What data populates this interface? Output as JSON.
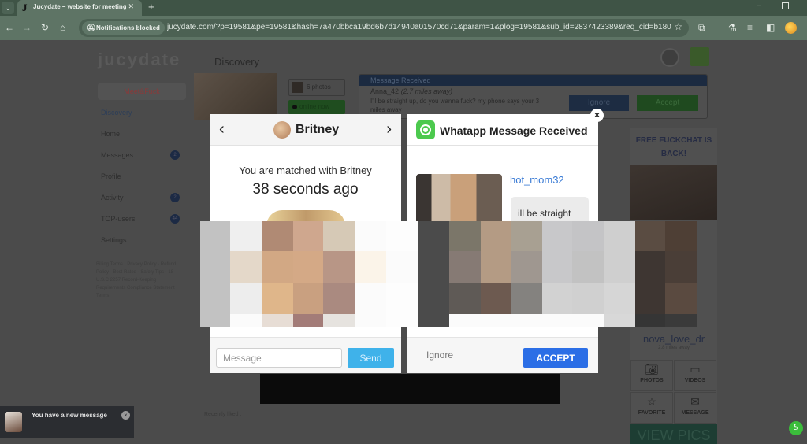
{
  "browser": {
    "tab_title": "Jucydate – website for meeting",
    "tab_favicon": "J",
    "new_tab": "+",
    "tab_close": "✕",
    "notifications_chip": "Notifications blocked",
    "url": "jucydate.com/?p=19581&pe=19581&hash=7a470bbca19bd6b7d14940a01570cd71&param=1&plog=19581&sub_id=2837423389&req_cid=b18098...",
    "icons": [
      "back-icon",
      "forward-icon",
      "reload-icon",
      "home-icon",
      "star-icon",
      "extensions-icon",
      "labs-icon",
      "reading-list-icon",
      "side-panel-icon",
      "profile-icon"
    ]
  },
  "site": {
    "logo": "jucydate",
    "meet_button": "Meet&Fuck",
    "sidebar": [
      {
        "label": "Discovery",
        "badge": ""
      },
      {
        "label": "Home",
        "badge": ""
      },
      {
        "label": "Messages",
        "badge": "2"
      },
      {
        "label": "Profile",
        "badge": ""
      },
      {
        "label": "Activity",
        "badge": "2"
      },
      {
        "label": "TOP-users",
        "badge": "44"
      },
      {
        "label": "Settings",
        "badge": ""
      }
    ],
    "footer_links": "Billing Terms · Privacy Policy · Refund Policy · Best Rated · Safety Tips · 18 U.S.C 2257 Record-Keeping Requirements Compliance Statement · Terms",
    "page_title": "Discovery",
    "photos_count": "6 photos",
    "online_status": "online now",
    "message_card": {
      "header": "Message Received",
      "sender": "Anna_42",
      "distance": "(2.7 miles away)",
      "text": "I'll be straight up, do you wanna fuck? my phone says your 3 miles away",
      "ignore": "Ignore",
      "accept": "Accept"
    },
    "side_ad": {
      "title": "FREE FUCKCHAT IS BACK!",
      "username": "nova_love_dr",
      "distance": "2.8 miles away",
      "actions": [
        {
          "label": "PHOTOS",
          "icon": "camera-icon"
        },
        {
          "label": "VIDEOS",
          "icon": "video-icon"
        },
        {
          "label": "FAVORITE",
          "icon": "star-icon"
        },
        {
          "label": "MESSAGE",
          "icon": "envelope-icon"
        }
      ],
      "cta": "VIEW PICS"
    },
    "recently_liked": "Recently liked :"
  },
  "modal": {
    "left": {
      "name": "Britney",
      "prev": "‹",
      "next": "›",
      "matched_text": "You are matched with Britney",
      "time_ago": "38 seconds ago",
      "message_placeholder": "Message",
      "send_label": "Send"
    },
    "right": {
      "title": "Whatapp Message Received",
      "username": "hot_mom32",
      "message": "ill be straight",
      "ignore_label": "Ignore",
      "accept_label": "ACCEPT"
    },
    "close": "×"
  },
  "toast": {
    "text": "You have a new message",
    "close": "×"
  },
  "colors": {
    "accept_blue": "#2b6ee6",
    "send_blue": "#3fb2ea",
    "whatsapp_green": "#4cc94e",
    "username_blue": "#3a7bd5",
    "browser_green": "#5e7465"
  }
}
